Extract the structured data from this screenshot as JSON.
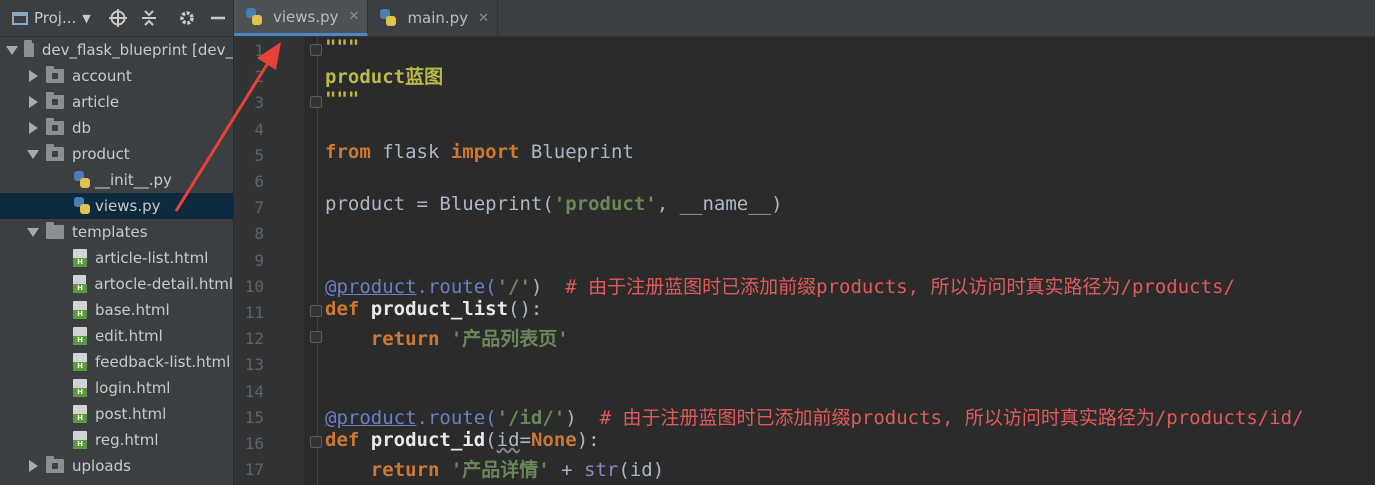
{
  "project_panel": {
    "selector_label": "Proj...",
    "toolbar_icons": [
      "target-icon",
      "collapse-icon",
      "gear-icon",
      "minimize-icon"
    ],
    "tree": [
      {
        "label": "dev_flask_blueprint [dev_",
        "type": "root-folder",
        "expanded": true,
        "depth": 0
      },
      {
        "label": "account",
        "type": "folder",
        "expanded": false,
        "depth": 1
      },
      {
        "label": "article",
        "type": "folder",
        "expanded": false,
        "depth": 1
      },
      {
        "label": "db",
        "type": "folder",
        "expanded": false,
        "depth": 1
      },
      {
        "label": "product",
        "type": "folder",
        "expanded": true,
        "depth": 1
      },
      {
        "label": "__init__.py",
        "type": "python",
        "depth": 2
      },
      {
        "label": "views.py",
        "type": "python",
        "depth": 2,
        "selected": true
      },
      {
        "label": "templates",
        "type": "folder",
        "expanded": true,
        "depth": 1
      },
      {
        "label": "article-list.html",
        "type": "html",
        "depth": 2
      },
      {
        "label": "artocle-detail.html",
        "type": "html",
        "depth": 2
      },
      {
        "label": "base.html",
        "type": "html",
        "depth": 2
      },
      {
        "label": "edit.html",
        "type": "html",
        "depth": 2
      },
      {
        "label": "feedback-list.html",
        "type": "html",
        "depth": 2
      },
      {
        "label": "login.html",
        "type": "html",
        "depth": 2
      },
      {
        "label": "post.html",
        "type": "html",
        "depth": 2
      },
      {
        "label": "reg.html",
        "type": "html",
        "depth": 2
      },
      {
        "label": "uploads",
        "type": "folder",
        "expanded": false,
        "depth": 1
      }
    ]
  },
  "tabs": [
    {
      "label": "views.py",
      "active": true
    },
    {
      "label": "main.py",
      "active": false
    }
  ],
  "line_numbers": [
    "1",
    "2",
    "3",
    "4",
    "5",
    "6",
    "7",
    "8",
    "9",
    "10",
    "11",
    "12",
    "13",
    "14",
    "15",
    "16",
    "17"
  ],
  "code": {
    "l1": "\"\"\"",
    "l2a": "product",
    "l2b": "蓝图",
    "l3": "\"\"\"",
    "l5_from": "from",
    "l5_mod": " flask ",
    "l5_import": "import",
    "l5_name": " Blueprint",
    "l7_var": "product = Blueprint(",
    "l7_str": "'product'",
    "l7_rest": ", __name__)",
    "l10_at": "@",
    "l10_obj": "product",
    "l10_route": ".route(",
    "l10_str": "'/'",
    "l10_close": ")  ",
    "l10_cmt": "# 由于注册蓝图时已添加前缀products, 所以访问时真实路径为/products/",
    "l11_def": "def",
    "l11_fn": " product_list",
    "l11_rest": "():",
    "l12_ret": "    return",
    "l12_str": " '产品列表页'",
    "l15_at": "@",
    "l15_obj": "product",
    "l15_route": ".route(",
    "l15_str": "'/id/'",
    "l15_close": ")  ",
    "l15_cmt": "# 由于注册蓝图时已添加前缀products, 所以访问时真实路径为/products/id/",
    "l16_def": "def",
    "l16_fn": " product_id",
    "l16_open": "(",
    "l16_param": "id",
    "l16_eq": "=",
    "l16_none": "None",
    "l16_close": "):",
    "l17_ret": "    return",
    "l17_str": " '产品详情'",
    "l17_plus": " + ",
    "l17_fn": "str",
    "l17_rest": "(id)"
  },
  "colors": {
    "accent_tab_underline": "#4a88c7",
    "annotation_arrow": "#e8413a"
  }
}
